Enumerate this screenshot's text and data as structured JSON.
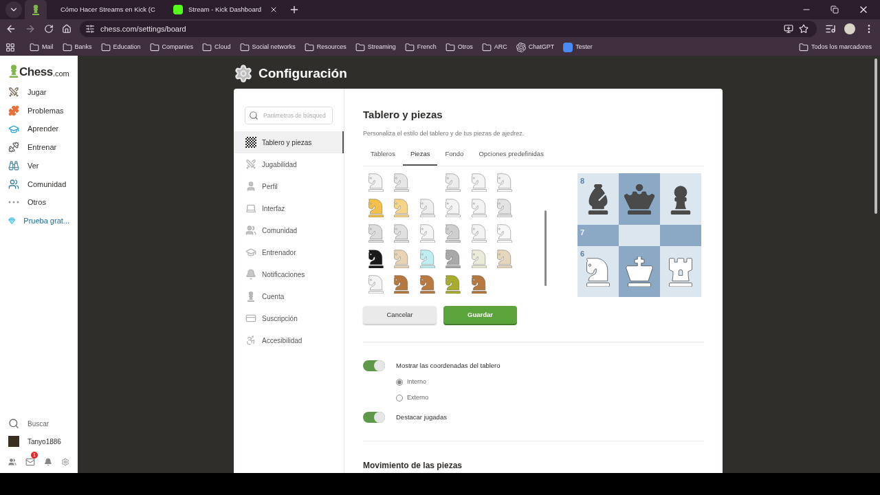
{
  "browser": {
    "tabs": [
      {
        "kind": "chess",
        "selected": true
      },
      {
        "title": "Cómo Hacer Streams en Kick (C",
        "kind": "youtube",
        "selected": false
      },
      {
        "title": "Stream - Kick Dashboard",
        "kind": "kick",
        "selected": false
      }
    ],
    "url": "chess.com/settings/board",
    "bookmarks": [
      {
        "label": "Mail",
        "kind": "folder"
      },
      {
        "label": "Banks",
        "kind": "folder"
      },
      {
        "label": "Education",
        "kind": "folder"
      },
      {
        "label": "Companies",
        "kind": "folder"
      },
      {
        "label": "Cloud",
        "kind": "folder"
      },
      {
        "label": "Social networks",
        "kind": "folder"
      },
      {
        "label": "Resources",
        "kind": "folder"
      },
      {
        "label": "Streaming",
        "kind": "folder"
      },
      {
        "label": "French",
        "kind": "folder"
      },
      {
        "label": "Otros",
        "kind": "folder"
      },
      {
        "label": "ARC",
        "kind": "folder"
      },
      {
        "label": "ChatGPT",
        "kind": "chatgpt"
      },
      {
        "label": "Tester",
        "kind": "doc"
      }
    ],
    "all_bookmarks": "Todos los marcadores"
  },
  "sidebar": {
    "logo": "Chess",
    "logo_suffix": ".com",
    "items": [
      {
        "label": "Jugar",
        "kind": "play"
      },
      {
        "label": "Problemas",
        "kind": "puzzle"
      },
      {
        "label": "Aprender",
        "kind": "learn"
      },
      {
        "label": "Entrenar",
        "kind": "train"
      },
      {
        "label": "Ver",
        "kind": "watch"
      },
      {
        "label": "Comunidad",
        "kind": "community"
      },
      {
        "label": "Otros",
        "kind": "more"
      },
      {
        "label": "Prueba grat...",
        "kind": "premium"
      }
    ],
    "search": "Buscar",
    "user": "Tanyo1886",
    "mail_badge": "1"
  },
  "page_title": "Configuración",
  "settings_nav": {
    "placeholder": "Parámetros de búsqued",
    "items": [
      {
        "label": "Tablero y piezas",
        "kind": "board",
        "selected": true
      },
      {
        "label": "Jugabilidad",
        "kind": "play",
        "selected": false
      },
      {
        "label": "Perfil",
        "kind": "profile",
        "selected": false
      },
      {
        "label": "Interfaz",
        "kind": "laptop",
        "selected": false
      },
      {
        "label": "Comunidad",
        "kind": "community",
        "selected": false
      },
      {
        "label": "Entrenador",
        "kind": "coach",
        "selected": false
      },
      {
        "label": "Notificaciones",
        "kind": "bell",
        "selected": false
      },
      {
        "label": "Cuenta",
        "kind": "account",
        "selected": false
      },
      {
        "label": "Suscripción",
        "kind": "card",
        "selected": false
      },
      {
        "label": "Accesibilidad",
        "kind": "access",
        "selected": false
      }
    ]
  },
  "panel": {
    "heading": "Tablero y piezas",
    "subtitle": "Personaliza el estilo del tablero y de tus piezas de ajedrez.",
    "tabs": [
      {
        "label": "Tableros",
        "selected": false
      },
      {
        "label": "Piezas",
        "selected": true
      },
      {
        "label": "Fondo",
        "selected": false
      },
      {
        "label": "Opciones predefinidas",
        "selected": false
      }
    ],
    "piece_rows": [
      [
        {
          "kind": "knight",
          "color": "#f2f2f2"
        },
        {
          "kind": "knight",
          "color": "#e6e6e6"
        },
        {
          "kind": "empty"
        },
        {
          "kind": "knight",
          "color": "#ececec"
        },
        {
          "kind": "knight",
          "color": "#f4f4f4"
        },
        {
          "kind": "knight",
          "color": "#f2f2f2"
        }
      ],
      [
        {
          "kind": "knight",
          "color": "#f3c04a"
        },
        {
          "kind": "knight",
          "color": "#f5d48a"
        },
        {
          "kind": "knight",
          "color": "#eeeeee"
        },
        {
          "kind": "knight",
          "color": "#f4f4f4"
        },
        {
          "kind": "knight",
          "color": "#f3f3f3"
        },
        {
          "kind": "knight",
          "color": "#e3e3e3"
        }
      ],
      [
        {
          "kind": "knight",
          "color": "#dcdcdc"
        },
        {
          "kind": "knight",
          "color": "#e0e0e0"
        },
        {
          "kind": "knight",
          "color": "#f4f4f4"
        },
        {
          "kind": "knight",
          "color": "#cfcfcf"
        },
        {
          "kind": "knight",
          "color": "#f3f3f3"
        },
        {
          "kind": "knight",
          "color": "#f8f8f8"
        }
      ],
      [
        {
          "kind": "knight",
          "color": "#1a1a1a"
        },
        {
          "kind": "knight",
          "color": "#e8d3b5"
        },
        {
          "kind": "knight",
          "color": "#bfeef0"
        },
        {
          "kind": "knight",
          "color": "#a9a9a9"
        },
        {
          "kind": "knight",
          "color": "#ecebd8"
        },
        {
          "kind": "knight",
          "color": "#e6d6bc"
        }
      ],
      [
        {
          "kind": "knight",
          "color": "#f4f4f4"
        },
        {
          "kind": "knight",
          "color": "#b5783f"
        },
        {
          "kind": "knight",
          "color": "#b87a40"
        },
        {
          "kind": "knight",
          "color": "#a8ac2c"
        },
        {
          "kind": "knight",
          "color": "#b5783f"
        }
      ]
    ],
    "cancel": "Cancelar",
    "save": "Guardar",
    "board": [
      [
        {
          "color": "#dce6ee",
          "rank": "8",
          "piece": {
            "kind": "bishop",
            "color": "#4a4a4a"
          }
        },
        {
          "color": "#8ba9c4",
          "piece": {
            "kind": "queen",
            "color": "#4a4a4a"
          }
        },
        {
          "color": "#dce6ee",
          "piece": {
            "kind": "pawn",
            "color": "#4a4a4a"
          }
        }
      ],
      [
        {
          "color": "#8ba9c4",
          "rank": "7"
        },
        {
          "color": "#dce6ee"
        },
        {
          "color": "#8ba9c4"
        }
      ],
      [
        {
          "color": "#dce6ee",
          "rank": "6",
          "piece": {
            "kind": "knight",
            "color": "#ffffff"
          }
        },
        {
          "color": "#8ba9c4",
          "piece": {
            "kind": "king",
            "color": "#ffffff"
          }
        },
        {
          "color": "#dce6ee",
          "piece": {
            "kind": "rook",
            "color": "#ffffff"
          }
        }
      ]
    ],
    "coordinates": {
      "label": "Mostrar las coordenadas del tablero",
      "on": true,
      "options": [
        {
          "label": "Interno",
          "selected": true
        },
        {
          "label": "Externo",
          "selected": false
        }
      ]
    },
    "highlight": {
      "label": "Destacar jugadas",
      "on": true
    },
    "section": "Movimiento de las piezas"
  }
}
